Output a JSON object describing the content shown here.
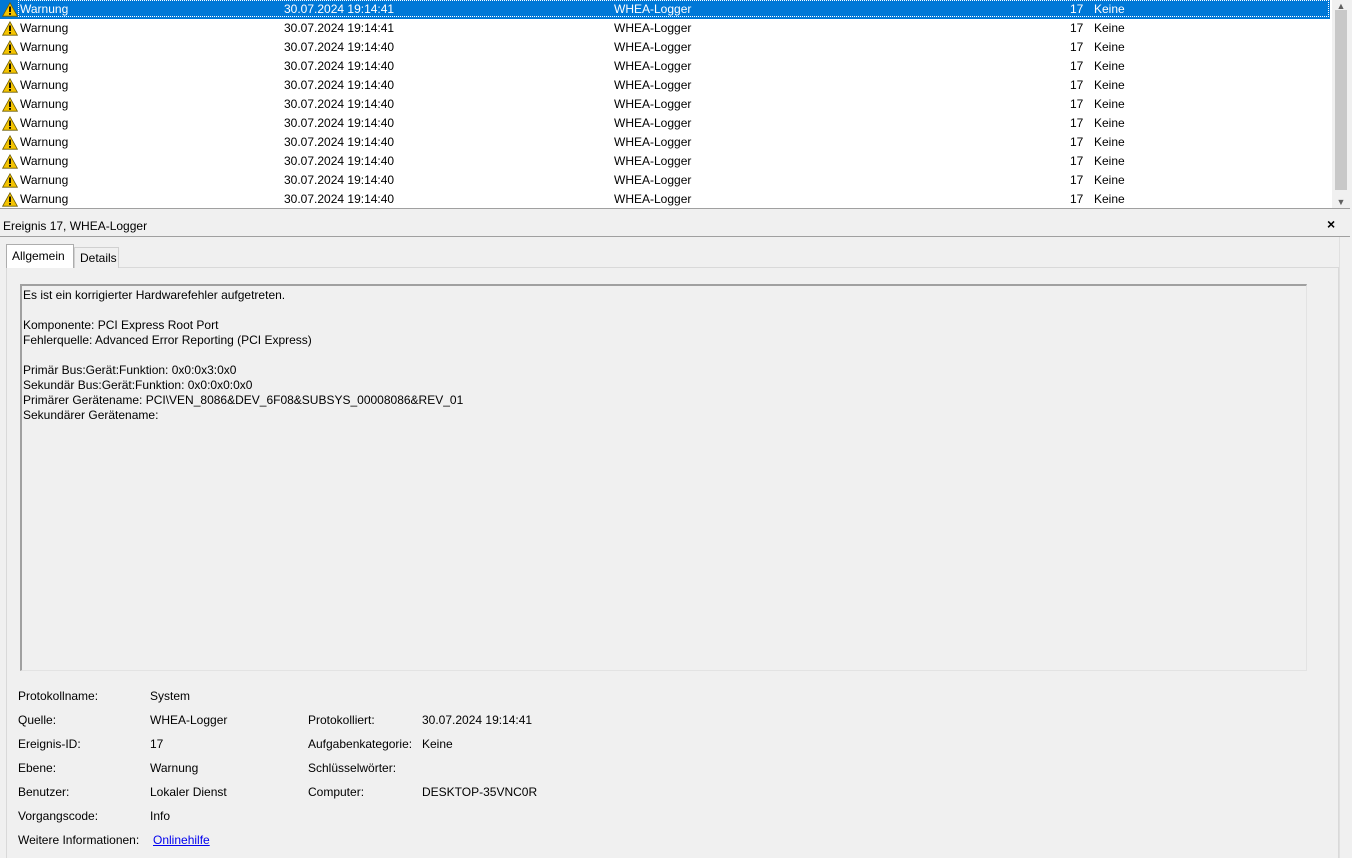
{
  "event_list": {
    "rows": [
      {
        "level": "Warnung",
        "date": "30.07.2024 19:14:41",
        "source": "WHEA-Logger",
        "id": "17",
        "category": "Keine"
      },
      {
        "level": "Warnung",
        "date": "30.07.2024 19:14:41",
        "source": "WHEA-Logger",
        "id": "17",
        "category": "Keine"
      },
      {
        "level": "Warnung",
        "date": "30.07.2024 19:14:40",
        "source": "WHEA-Logger",
        "id": "17",
        "category": "Keine"
      },
      {
        "level": "Warnung",
        "date": "30.07.2024 19:14:40",
        "source": "WHEA-Logger",
        "id": "17",
        "category": "Keine"
      },
      {
        "level": "Warnung",
        "date": "30.07.2024 19:14:40",
        "source": "WHEA-Logger",
        "id": "17",
        "category": "Keine"
      },
      {
        "level": "Warnung",
        "date": "30.07.2024 19:14:40",
        "source": "WHEA-Logger",
        "id": "17",
        "category": "Keine"
      },
      {
        "level": "Warnung",
        "date": "30.07.2024 19:14:40",
        "source": "WHEA-Logger",
        "id": "17",
        "category": "Keine"
      },
      {
        "level": "Warnung",
        "date": "30.07.2024 19:14:40",
        "source": "WHEA-Logger",
        "id": "17",
        "category": "Keine"
      },
      {
        "level": "Warnung",
        "date": "30.07.2024 19:14:40",
        "source": "WHEA-Logger",
        "id": "17",
        "category": "Keine"
      },
      {
        "level": "Warnung",
        "date": "30.07.2024 19:14:40",
        "source": "WHEA-Logger",
        "id": "17",
        "category": "Keine"
      },
      {
        "level": "Warnung",
        "date": "30.07.2024 19:14:40",
        "source": "WHEA-Logger",
        "id": "17",
        "category": "Keine"
      }
    ],
    "selected_index": 0,
    "icon": "warning-icon"
  },
  "detail": {
    "title": "Ereignis 17, WHEA-Logger",
    "close_label": "×",
    "tabs": [
      {
        "label": "Allgemein"
      },
      {
        "label": "Details"
      }
    ],
    "description": {
      "line1": "Es ist ein korrigierter Hardwarefehler aufgetreten.",
      "line2": "Komponente: PCI Express Root Port",
      "line3": "Fehlerquelle: Advanced Error Reporting (PCI Express)",
      "line4": "Primär Bus:Gerät:Funktion: 0x0:0x3:0x0",
      "line5": "Sekundär Bus:Gerät:Funktion: 0x0:0x0:0x0",
      "line6": "Primärer Gerätename: PCI\\VEN_8086&DEV_6F08&SUBSYS_00008086&REV_01",
      "line7": "Sekundärer Gerätename:"
    },
    "fields": {
      "protokollname_label": "Protokollname:",
      "protokollname_value": "System",
      "quelle_label": "Quelle:",
      "quelle_value": "WHEA-Logger",
      "protokolliert_label": "Protokolliert:",
      "protokolliert_value": "30.07.2024 19:14:41",
      "ereignis_id_label": "Ereignis-ID:",
      "ereignis_id_value": "17",
      "aufgabenkategorie_label": "Aufgabenkategorie:",
      "aufgabenkategorie_value": "Keine",
      "ebene_label": "Ebene:",
      "ebene_value": "Warnung",
      "schluesselwoerter_label": "Schlüsselwörter:",
      "schluesselwoerter_value": "",
      "benutzer_label": "Benutzer:",
      "benutzer_value": "Lokaler Dienst",
      "computer_label": "Computer:",
      "computer_value": "DESKTOP-35VNC0R",
      "vorgangscode_label": "Vorgangscode:",
      "vorgangscode_value": "Info",
      "weitere_label": "Weitere Informationen:",
      "weitere_link": "Onlinehilfe"
    }
  },
  "colors": {
    "selection": "#0078d7",
    "warning_yellow": "#f5c400",
    "link": "#0000ee",
    "window_bg": "#f0f0f0"
  }
}
